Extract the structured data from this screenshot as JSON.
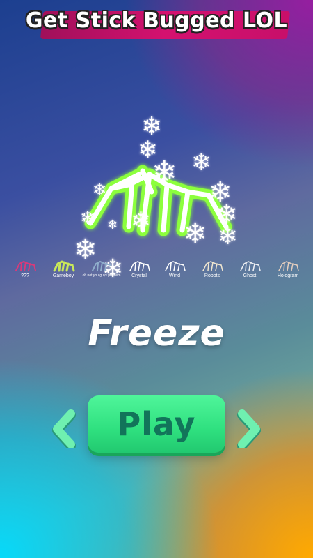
{
  "header": {
    "title": "Get Stick Bugged LOL"
  },
  "preview": {
    "effect_icon": "snowflake-icon",
    "stick_color": "#ffffff",
    "glow_color": "#8cff3c"
  },
  "skins": [
    {
      "label": "???",
      "color": "#d93a7a"
    },
    {
      "label": "Gameboy",
      "color": "#c9e85a"
    },
    {
      "label": "oh not you guys problem",
      "color": "#8faecc"
    },
    {
      "label": "Crystal",
      "color": "#ffffff"
    },
    {
      "label": "Wind",
      "color": "#ffffff"
    },
    {
      "label": "Robots",
      "color": "#f0e6d0"
    },
    {
      "label": "Ghost",
      "color": "#ffffff"
    },
    {
      "label": "Hologram",
      "color": "#f3d7c2"
    }
  ],
  "current_effect": {
    "name": "Freeze"
  },
  "controls": {
    "play_label": "Play",
    "prev_icon": "chevron-left-icon",
    "next_icon": "chevron-right-icon",
    "button_color": "#3ae98a",
    "arrow_color": "#6ff0b0"
  }
}
